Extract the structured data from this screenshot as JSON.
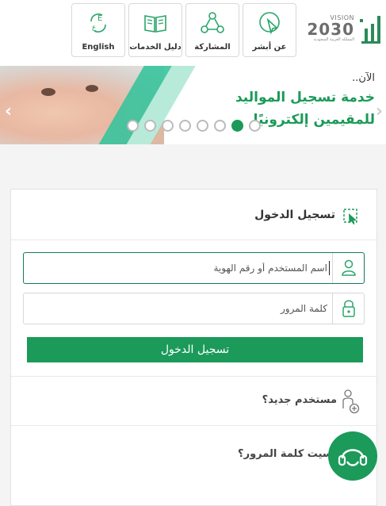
{
  "header": {
    "vision_label": "VISION",
    "vision_year": "2030",
    "vision_sub": "المملكة العربية السعودية",
    "nav": [
      {
        "label": "English",
        "icon": "language-icon"
      },
      {
        "label": "دليل الخدمات",
        "icon": "book-icon"
      },
      {
        "label": "المشاركة",
        "icon": "share-network-icon"
      },
      {
        "label": "عن أبشر",
        "icon": "cursor-click-icon"
      }
    ]
  },
  "banner": {
    "now_text": "الآن..",
    "line1": "خدمة تسجيل المواليد",
    "line2": "للمقيمين إلكترونيًا",
    "slides": 8,
    "active_slide": 6
  },
  "login": {
    "title": "تسجيل الدخول",
    "username_placeholder": "اسم المستخدم أو رقم الهوية",
    "password_placeholder": "كلمة المرور",
    "submit_label": "تسجيل الدخول",
    "new_user": "مستخدم جديد؟",
    "forgot_password": "نسيت كلمة المرور؟"
  },
  "colors": {
    "brand_green": "#1b9a5a",
    "accent_teal": "#39c39c"
  }
}
